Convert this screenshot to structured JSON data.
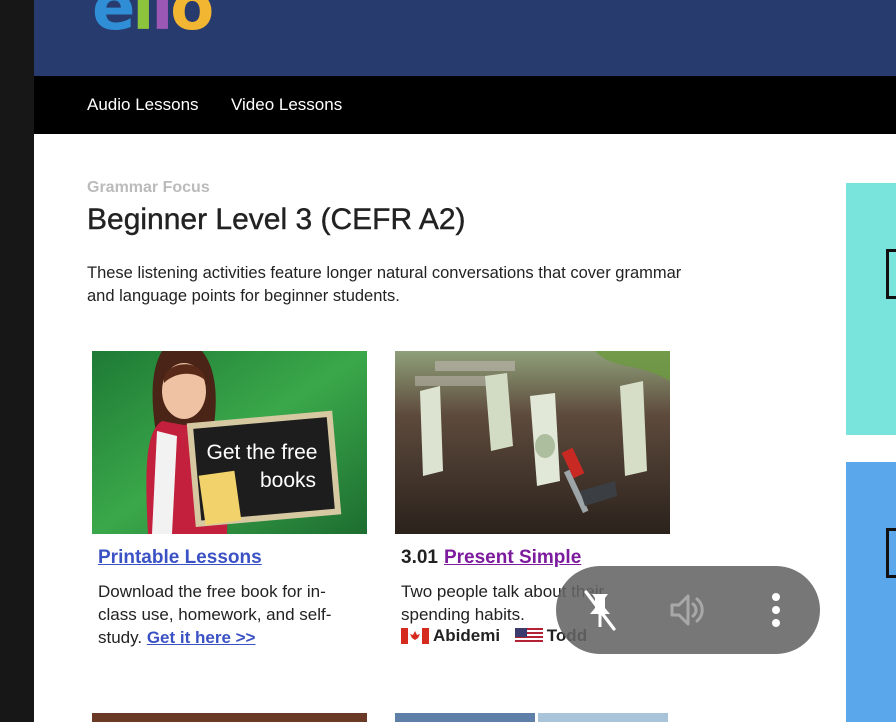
{
  "header": {
    "logo_letters": [
      "e",
      "l",
      "l",
      "o"
    ]
  },
  "nav": {
    "items": [
      "Audio Lessons",
      "Video Lessons"
    ]
  },
  "page": {
    "kicker": "Grammar Focus",
    "title": "Beginner Level 3 (CEFR A2)",
    "description": "These listening activities feature longer natural conversations that cover grammar and language points for beginner students."
  },
  "cards": [
    {
      "title": "Printable Lessons",
      "text": "Download the free book for in-class use, homework, and self-study.",
      "link": "Get it here >>",
      "image_text": [
        "Get the free",
        "books"
      ]
    },
    {
      "number": "3.01",
      "title": "Present Simple",
      "text": "Two people talk about their spending habits.",
      "speakers": [
        "Abidemi",
        "Todd"
      ]
    }
  ],
  "icons": {
    "pin": "unpin-icon",
    "volume": "volume-icon",
    "more": "more-vertical-icon",
    "flag_1": "canada-flag-icon",
    "flag_2": "usa-flag-icon"
  },
  "colors": {
    "header_bg": "#283b6e",
    "nav_bg": "#000000",
    "link_blue": "#3b52c4",
    "link_purple": "#7c1b9e",
    "side_teal": "#79e4dc",
    "side_blue": "#5aa7ec"
  }
}
